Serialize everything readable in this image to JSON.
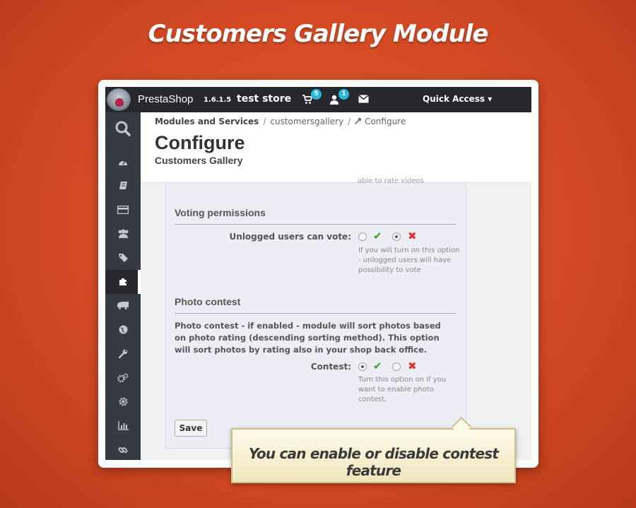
{
  "headline": "Customers Gallery Module",
  "topbar": {
    "brand_presta": "Presta",
    "brand_shop": "Shop",
    "version": "1.6.1.5",
    "store": "test store",
    "cart_badge": "5",
    "customer_badge": "1",
    "quick_access": "Quick Access ▾",
    "icons": [
      "cart-icon",
      "user-icon",
      "envelope-icon"
    ]
  },
  "sidebar": {
    "items": [
      {
        "icon": "search-icon",
        "glyph": "⌕"
      },
      {
        "icon": "dashboard-icon",
        "glyph": "◔"
      },
      {
        "icon": "orders-icon",
        "glyph": "▤"
      },
      {
        "icon": "catalog-icon",
        "glyph": "▭"
      },
      {
        "icon": "customers-icon",
        "glyph": "●●"
      },
      {
        "icon": "price-rules-icon",
        "glyph": "◆"
      },
      {
        "icon": "modules-icon",
        "glyph": "✚",
        "active": true
      },
      {
        "icon": "shipping-icon",
        "glyph": "▰"
      },
      {
        "icon": "localization-icon",
        "glyph": "◉"
      },
      {
        "icon": "preferences-icon",
        "glyph": "✎"
      },
      {
        "icon": "advanced-parameters-icon",
        "glyph": "✲"
      },
      {
        "icon": "administration-icon",
        "glyph": "✹"
      },
      {
        "icon": "stats-icon",
        "glyph": "▥"
      },
      {
        "icon": "link-icon",
        "glyph": "∞"
      }
    ]
  },
  "breadcrumb": {
    "item1": "Modules and Services",
    "item2": "customersgallery",
    "item3": "Configure",
    "separator": "/"
  },
  "page": {
    "title": "Configure",
    "subtitle": "Customers Gallery"
  },
  "form": {
    "cut_text": "able to rate videos",
    "voting": {
      "title": "Voting permissions",
      "label": "Unlogged users can vote:",
      "help": "If you will turn on this option - unlogged users will have possibility to vote",
      "value": "no"
    },
    "contest": {
      "title": "Photo contest",
      "description": "Photo contest - if enabled - module will sort photos based on photo rating (descending sorting method). This option will sort photos by rating also in your shop back office.",
      "label": "Contest:",
      "help": "Turn this option on if you want to enable photo contest.",
      "value": "yes"
    },
    "save_label": "Save"
  },
  "callout": "You can enable or disable contest feature",
  "colors": {
    "background": "#d24a24",
    "topbar": "#25292e",
    "sidebar": "#363a41",
    "badge": "#25b9d7",
    "check": "#3a9d2a",
    "cross": "#e0302f"
  }
}
